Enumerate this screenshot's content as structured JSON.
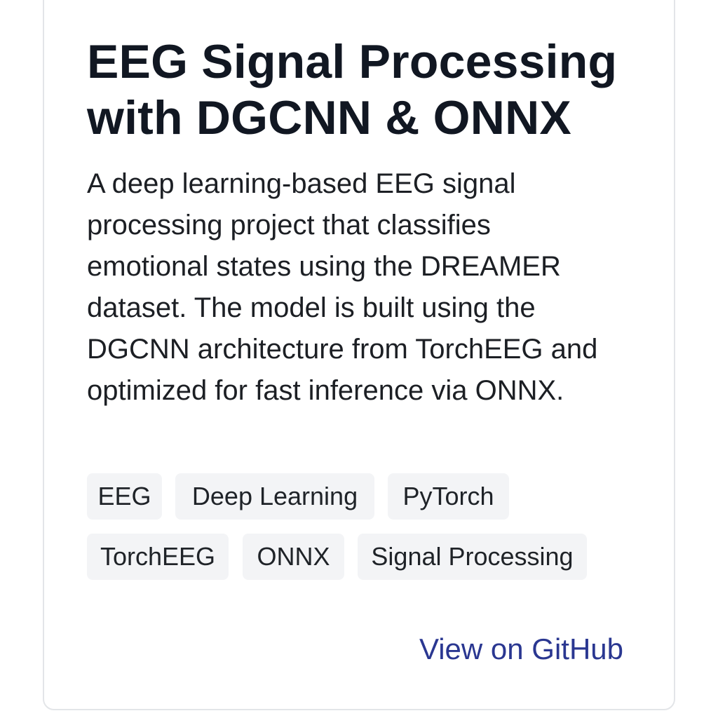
{
  "project": {
    "title": "EEG Signal Processing with DGCNN & ONNX",
    "description": "A deep learning-based EEG signal processing project that classifies emotional states using the DREAMER dataset. The model is built using the DGCNN architecture from TorchEEG and optimized for fast inference via ONNX.",
    "tags": [
      "EEG",
      "Deep Learning",
      "PyTorch",
      "TorchEEG",
      "ONNX",
      "Signal Processing"
    ],
    "link_label": "View on GitHub"
  },
  "colors": {
    "title": "#111722",
    "text": "#1c1f24",
    "tag_background": "#f3f4f6",
    "link": "#2a3791",
    "card_border": "#e3e5e8"
  }
}
